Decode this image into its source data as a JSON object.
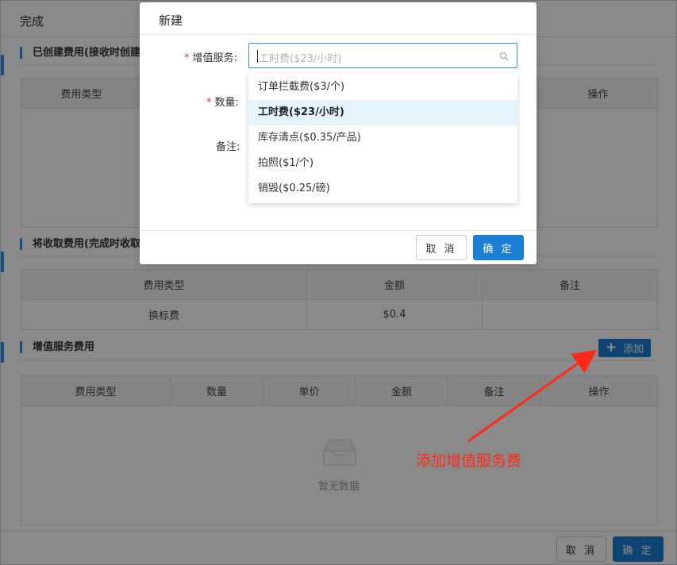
{
  "page": {
    "title": "完成",
    "sections": {
      "created_fees": "已创建费用(接收时创建",
      "to_collect_fees": "将收取费用(完成时收取",
      "value_added_fees": "增值服务费用"
    },
    "created_table": {
      "headers": [
        "费用类型",
        "操作"
      ]
    },
    "collect_table": {
      "headers": [
        "费用类型",
        "金额",
        "备注"
      ],
      "rows": [
        [
          "换标费",
          "$0.4",
          ""
        ]
      ]
    },
    "value_added_table": {
      "headers": [
        "费用类型",
        "数量",
        "单价",
        "金额",
        "备注",
        "操作"
      ],
      "empty_text": "暂无数据"
    },
    "add_button": "添加",
    "footer": {
      "cancel": "取 消",
      "confirm": "确 定"
    }
  },
  "modal": {
    "title": "新建",
    "fields": {
      "service_label": "增值服务:",
      "service_placeholder": "工时费($23/小时)",
      "quantity_label": "数量:",
      "note_label": "备注:"
    },
    "dropdown": {
      "options": [
        "订单拦截费($3/个)",
        "工时费($23/小时)",
        "库存清点($0.35/产品)",
        "拍照($1/个)",
        "销毁($0.25/磅)"
      ],
      "selected_index": 1
    },
    "footer": {
      "cancel": "取 消",
      "confirm": "确 定"
    }
  },
  "annotation": {
    "text": "添加增值服务费",
    "color": "#ff2a1a"
  },
  "colors": {
    "primary": "#1d7fd3",
    "accent_border": "#2d8cf0",
    "required": "#e33333"
  }
}
